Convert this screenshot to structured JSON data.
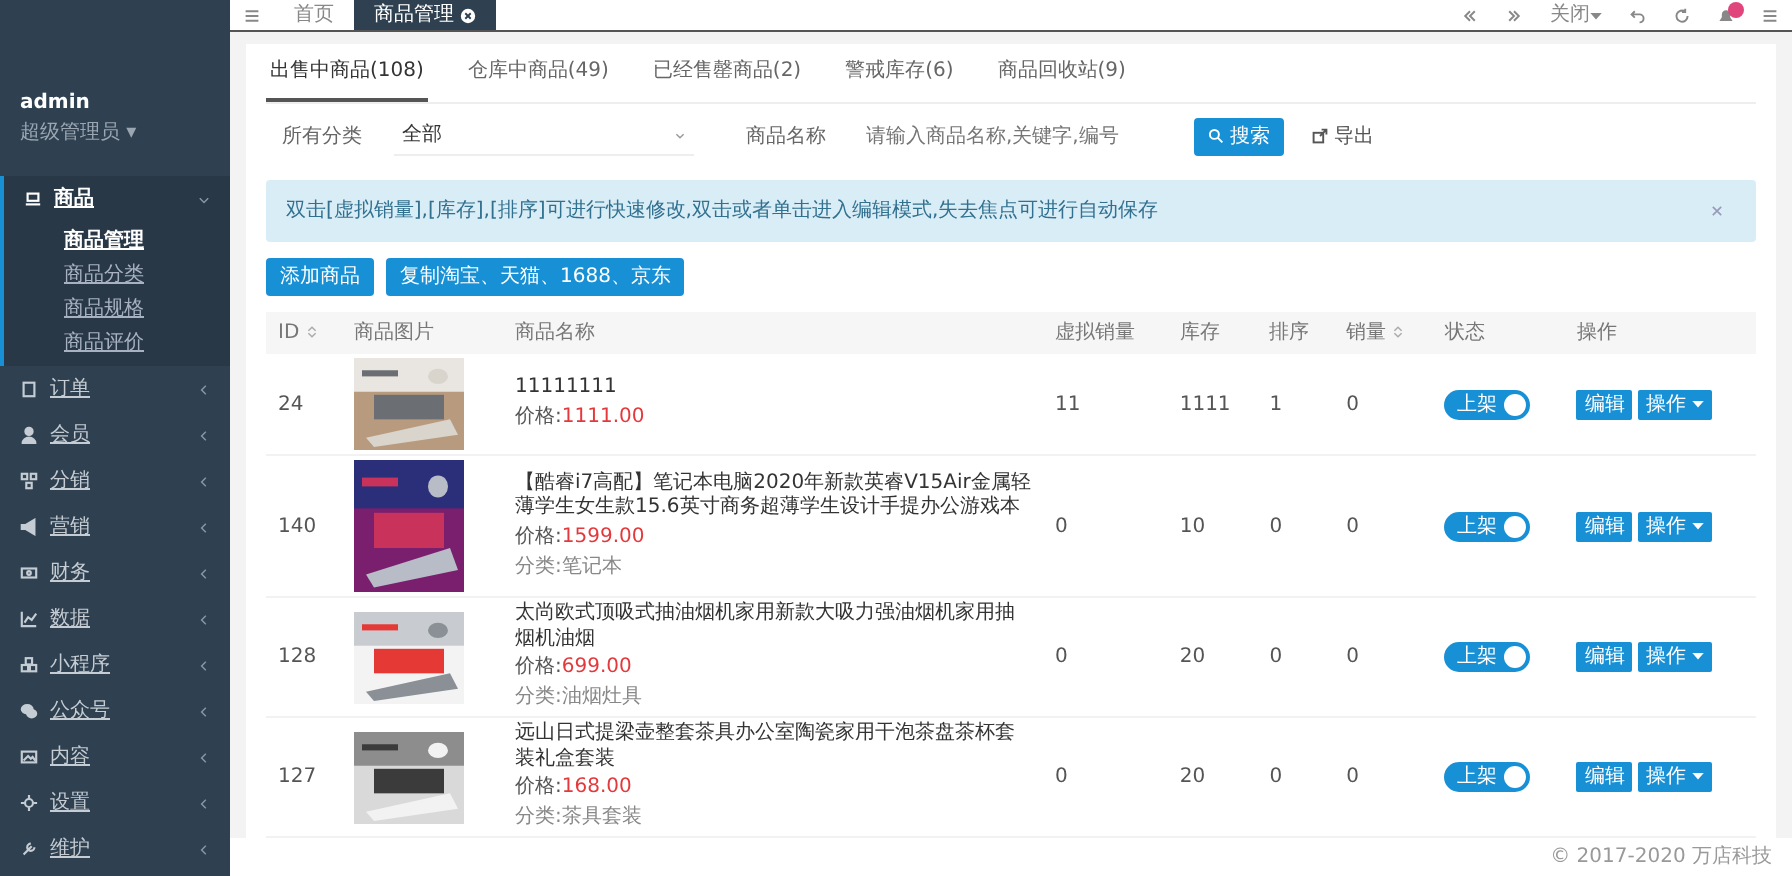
{
  "sidebar": {
    "user": {
      "name": "admin",
      "role": "超级管理员",
      "caret": "▾"
    },
    "items": [
      {
        "label": "商品",
        "expanded": true,
        "children": [
          {
            "label": "商品管理",
            "selected": true
          },
          {
            "label": "商品分类",
            "selected": false
          },
          {
            "label": "商品规格",
            "selected": false
          },
          {
            "label": "商品评价",
            "selected": false
          }
        ]
      },
      {
        "label": "订单",
        "expanded": false
      },
      {
        "label": "会员",
        "expanded": false
      },
      {
        "label": "分销",
        "expanded": false
      },
      {
        "label": "营销",
        "expanded": false
      },
      {
        "label": "财务",
        "expanded": false
      },
      {
        "label": "数据",
        "expanded": false
      },
      {
        "label": "小程序",
        "expanded": false
      },
      {
        "label": "公众号",
        "expanded": false
      },
      {
        "label": "内容",
        "expanded": false
      },
      {
        "label": "设置",
        "expanded": false
      },
      {
        "label": "维护",
        "expanded": false
      }
    ]
  },
  "topbar": {
    "tabs": [
      {
        "label": "首页",
        "selected": false,
        "closable": false
      },
      {
        "label": "商品管理",
        "selected": true,
        "closable": true
      }
    ],
    "close_menu": "关闭",
    "notifications": {
      "unread": true
    }
  },
  "page_tabs": [
    {
      "label": "出售中商品(108)",
      "selected": true
    },
    {
      "label": "仓库中商品(49)",
      "selected": false
    },
    {
      "label": "已经售罄商品(2)",
      "selected": false
    },
    {
      "label": "警戒库存(6)",
      "selected": false
    },
    {
      "label": "商品回收站(9)",
      "selected": false
    }
  ],
  "filter": {
    "category_label": "所有分类",
    "category_value": "全部",
    "name_label": "商品名称",
    "name_placeholder": "请输入商品名称,关键字,编号",
    "search_button": "搜索",
    "export_button": "导出"
  },
  "alert": "双击[虚拟销量],[库存],[排序]可进行快速修改,双击或者单击进入编辑模式,失去焦点可进行自动保存",
  "actions": [
    "添加商品",
    "复制淘宝、天猫、1688、京东"
  ],
  "table": {
    "columns": [
      "ID",
      "商品图片",
      "商品名称",
      "虚拟销量",
      "库存",
      "排序",
      "销量",
      "状态",
      "操作"
    ],
    "rows": [
      {
        "id": "24",
        "name": "11111111",
        "price_label": "价格:",
        "price": "1111.00",
        "category": "",
        "virtual_sales": "11",
        "stock": "1111",
        "sort": "1",
        "sales": "0",
        "status": {
          "label": "上架",
          "on": true
        },
        "edit": "编辑",
        "more": "操作"
      },
      {
        "id": "140",
        "name": "【酷睿i7高配】笔记本电脑2020年新款英睿V15Air金属轻薄学生女生款15.6英寸商务超薄学生设计手提办公游戏本",
        "price_label": "价格:",
        "price": "1599.00",
        "category": "分类:笔记本",
        "virtual_sales": "0",
        "stock": "10",
        "sort": "0",
        "sales": "0",
        "status": {
          "label": "上架",
          "on": true
        },
        "edit": "编辑",
        "more": "操作"
      },
      {
        "id": "128",
        "name": "太尚欧式顶吸式抽油烟机家用新款大吸力强油烟机家用抽烟机油烟",
        "price_label": "价格:",
        "price": "699.00",
        "category": "分类:油烟灶具",
        "virtual_sales": "0",
        "stock": "20",
        "sort": "0",
        "sales": "0",
        "status": {
          "label": "上架",
          "on": true
        },
        "edit": "编辑",
        "more": "操作"
      },
      {
        "id": "127",
        "name": "远山日式提梁壶整套茶具办公室陶瓷家用干泡茶盘茶杯套装礼盒套装",
        "price_label": "价格:",
        "price": "168.00",
        "category": "分类:茶具套装",
        "virtual_sales": "0",
        "stock": "20",
        "sort": "0",
        "sales": "0",
        "status": {
          "label": "上架",
          "on": true
        },
        "edit": "编辑",
        "more": "操作"
      }
    ]
  },
  "footer": "© 2017-2020 万店科技"
}
